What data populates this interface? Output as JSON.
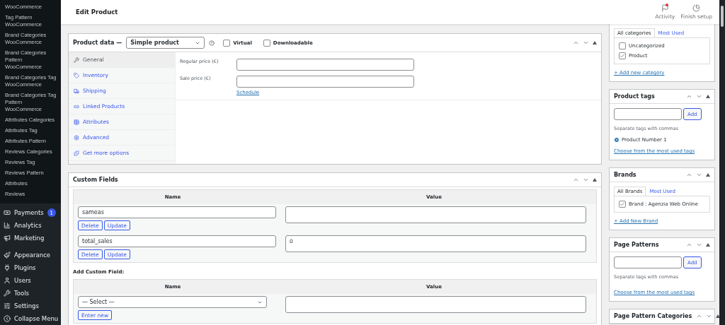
{
  "sidebar": {
    "submenu": [
      "WooCommerce",
      "Tag Pattern WooCommerce",
      "Brand Categories WooCommerce",
      "Brand Categories Pattern WooCommerce",
      "Brand Categories Tag WooCommerce",
      "Brand Categories Tag Pattern WooCommerce",
      "Attributes Categories",
      "Attributes Tag",
      "Attributes Pattern",
      "Reviews Categories",
      "Reviews Tag",
      "Reviews Pattern",
      "Attributes",
      "Reviews"
    ],
    "menu": [
      {
        "label": "Payments",
        "badge": "1"
      },
      {
        "label": "Analytics"
      },
      {
        "label": "Marketing"
      },
      {
        "label": "Appearance"
      },
      {
        "label": "Plugins"
      },
      {
        "label": "Users"
      },
      {
        "label": "Tools"
      },
      {
        "label": "Settings"
      },
      {
        "label": "Collapse Menu"
      }
    ]
  },
  "header": {
    "title": "Edit Product",
    "actions": [
      {
        "label": "Activity",
        "unread": true
      },
      {
        "label": "Finish setup"
      }
    ]
  },
  "product_data": {
    "title": "Product data —",
    "type": "Simple product",
    "options": [
      {
        "label": "Virtual",
        "checked": false
      },
      {
        "label": "Downloadable",
        "checked": false
      }
    ],
    "tabs": [
      {
        "label": "General",
        "selected": true
      },
      {
        "label": "Inventory",
        "selected": false
      },
      {
        "label": "Shipping",
        "selected": false
      },
      {
        "label": "Linked Products",
        "selected": false
      },
      {
        "label": "Attributes",
        "selected": false
      },
      {
        "label": "Advanced",
        "selected": false
      },
      {
        "label": "Get more options",
        "selected": false
      }
    ],
    "fields": [
      {
        "label": "Regular price (€)"
      },
      {
        "label": "Sale price (€)",
        "link": "Schedule"
      }
    ]
  },
  "custom_fields": {
    "title": "Custom Fields",
    "columns": [
      "Name",
      "Value"
    ],
    "rows": [
      {
        "name": "sameas",
        "buttons": [
          "Delete",
          "Update"
        ]
      },
      {
        "name": "total_sales",
        "value": "0",
        "buttons": [
          "Delete",
          "Update"
        ]
      }
    ],
    "add_title": "Add Custom Field:",
    "add_columns": [
      "Name",
      "Value"
    ],
    "add_select": "— Select —",
    "add_button": "Enter new"
  },
  "categories": {
    "tabs": [
      {
        "label": "All categories",
        "selected": true
      },
      {
        "label": "Most Used",
        "selected": false
      }
    ],
    "items": [
      {
        "label": "Uncategorized",
        "checked": false
      },
      {
        "label": "Product",
        "checked": true
      }
    ],
    "add_link": "+ Add new category"
  },
  "product_tags": {
    "title": "Product tags",
    "add_button": "Add",
    "hint": "Separate tags with commas",
    "tags": [
      "Product Number 1"
    ],
    "link": "Choose from the most used tags"
  },
  "brands": {
    "title": "Brands",
    "tabs": [
      {
        "label": "All Brands",
        "selected": true
      },
      {
        "label": "Most Used",
        "selected": false
      }
    ],
    "items": [
      {
        "label": "Brand : Agenzia Web Online",
        "checked": true
      }
    ],
    "add_link": "+ Add New Brand"
  },
  "page_patterns": {
    "title": "Page Patterns",
    "add_button": "Add",
    "hint": "Separate tags with commas",
    "link": "Choose from the most used tags"
  },
  "page_pattern_categories": {
    "title": "Page Pattern Categories"
  }
}
